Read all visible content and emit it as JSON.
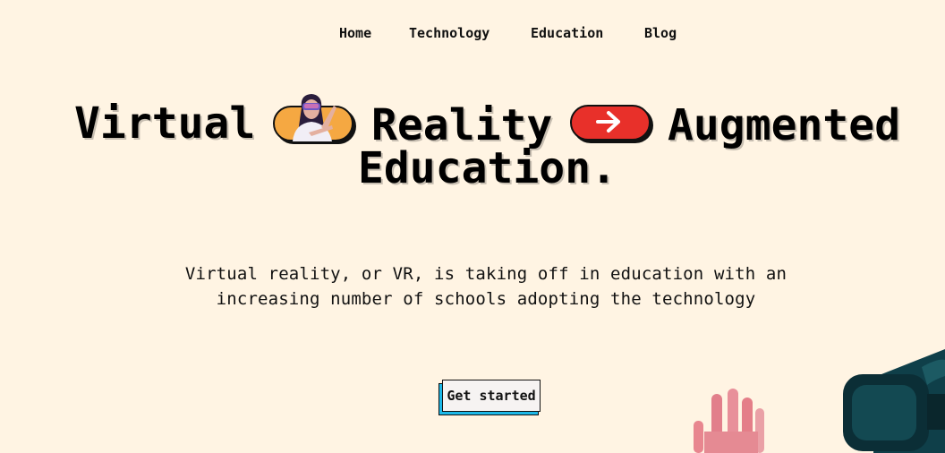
{
  "nav": {
    "items": [
      {
        "label": "Home"
      },
      {
        "label": "Technology"
      },
      {
        "label": "Education"
      },
      {
        "label": "Blog"
      }
    ]
  },
  "hero": {
    "word1": "Virtual",
    "word2": "Reality",
    "word3": "Augmented",
    "word4": "Education.",
    "person_icon": "vr-user-photo",
    "arrow_icon": "arrow-right-icon",
    "colors": {
      "pill_orange": "#f5a842",
      "pill_red": "#e8302a"
    }
  },
  "subtitle": {
    "line1": "Virtual reality, or VR, is taking off in education with an",
    "line2": "increasing number of schools adopting the technology"
  },
  "cta": {
    "label": "Get started",
    "accent_color": "#1cb8e8"
  },
  "decorations": {
    "hand": "raised-hand-image",
    "headset": "vr-headset-image"
  },
  "background_color": "#fff4e3"
}
